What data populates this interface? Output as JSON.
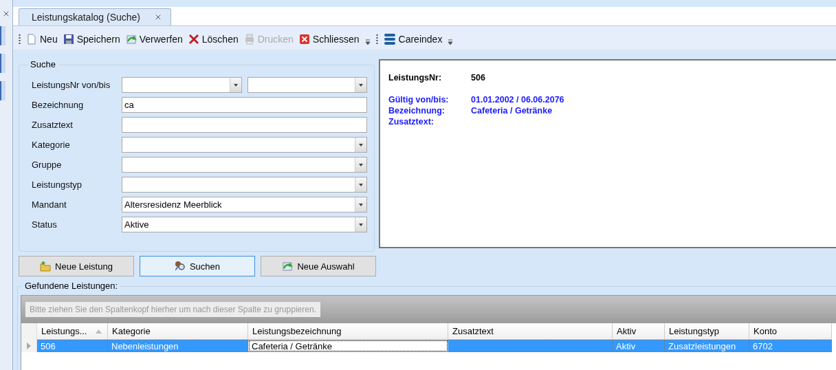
{
  "tab": {
    "title": "Leistungskatalog (Suche)",
    "selected": true
  },
  "toolbar": [
    {
      "kind": "grip"
    },
    {
      "kind": "button",
      "label": "Neu",
      "disabled": false
    },
    {
      "kind": "button",
      "label": "Speichern",
      "disabled": false
    },
    {
      "kind": "button",
      "label": "Verwerfen",
      "disabled": false
    },
    {
      "kind": "button",
      "label": "Löschen",
      "disabled": false
    },
    {
      "kind": "button",
      "label": "Drucken",
      "disabled": true
    },
    {
      "kind": "button",
      "label": "Schliessen",
      "disabled": false
    },
    {
      "kind": "overflow"
    },
    {
      "kind": "grip"
    },
    {
      "kind": "button",
      "label": "Careindex",
      "disabled": false
    },
    {
      "kind": "overflow"
    }
  ],
  "search": {
    "title": "Suche",
    "fields": [
      {
        "kind": "range",
        "label": "LeistungsNr von/bis"
      },
      {
        "kind": "text",
        "label": "Bezeichnung",
        "value": "ca"
      },
      {
        "kind": "text",
        "label": "Zusatztext"
      },
      {
        "kind": "combo",
        "label": "Kategorie"
      },
      {
        "kind": "combo",
        "label": "Gruppe"
      },
      {
        "kind": "combo",
        "label": "Leistungstyp"
      },
      {
        "kind": "combo",
        "label": "Mandant",
        "value": "Altersresidenz Meerblick"
      },
      {
        "kind": "combo",
        "label": "Status",
        "value": "Aktive"
      }
    ]
  },
  "preview": [
    {
      "label": "LeistungsNr:",
      "value": "506",
      "color": "#000000"
    },
    {
      "label": "Gültig von/bis:",
      "value": "01.01.2002 / 06.06.2076",
      "color": "#1a1aff"
    },
    {
      "label": "Bezeichnung:",
      "value": "Cafeteria / Getränke",
      "color": "#1a1aff"
    },
    {
      "label": "Zusatztext:",
      "color": "#1a1aff"
    }
  ],
  "actions": [
    {
      "label": "Neue Leistung",
      "selected": false
    },
    {
      "label": "Suchen",
      "selected": true
    },
    {
      "label": "Neue Auswahl",
      "selected": false
    }
  ],
  "results": {
    "title": "Gefundene Leistungen:",
    "group_hint": "Bitte ziehen Sie den Spaltenkopf hierher um nach dieser Spalte zu gruppieren.",
    "columns": [
      {
        "label": "Leistungs...",
        "sorted": true
      },
      {
        "label": "Kategorie",
        "sorted": false
      },
      {
        "label": "Leistungsbezeichnung",
        "sorted": false
      },
      {
        "label": "Zusatztext",
        "sorted": false
      },
      {
        "label": "Aktiv",
        "sorted": false
      },
      {
        "label": "Leistungstyp",
        "sorted": false
      },
      {
        "label": "Konto",
        "sorted": false
      }
    ],
    "rows": [
      {
        "selected": true,
        "cells": [
          {
            "text": "506",
            "focused": false
          },
          {
            "text": "Nebenleistungen",
            "focused": false
          },
          {
            "text": "Cafeteria / Getränke",
            "focused": true
          },
          {
            "focused": false
          },
          {
            "text": "Aktiv",
            "focused": false
          },
          {
            "text": "Zusatzleistungen",
            "focused": false
          },
          {
            "text": "6702",
            "focused": false
          }
        ]
      }
    ]
  }
}
